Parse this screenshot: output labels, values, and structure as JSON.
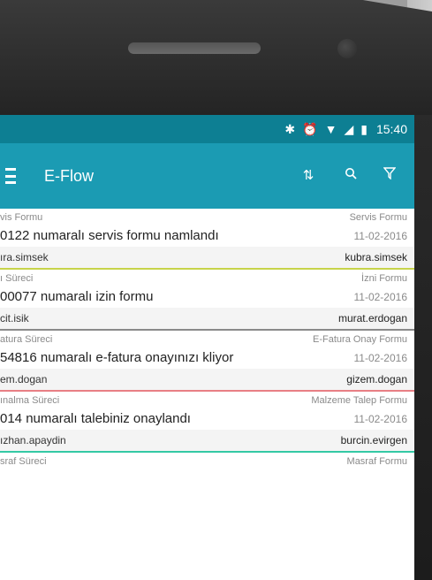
{
  "status_bar": {
    "time": "15:40",
    "icons": [
      "bluetooth-icon",
      "alarm-icon",
      "wifi-icon",
      "signal-icon",
      "battery-icon"
    ]
  },
  "app_bar": {
    "title": "E-Flow",
    "actions": [
      "sort-icon",
      "search-icon",
      "filter-icon"
    ]
  },
  "items": [
    {
      "process": "vis Formu",
      "form_type": "Servis Formu",
      "title": "0122 numaralı servis formu namlandı",
      "date": "11-02-2016",
      "from_user": "ıra.simsek",
      "to_user": "kubra.simsek",
      "accent": "#c7d34a"
    },
    {
      "process": "ı Süreci",
      "form_type": "İzni Formu",
      "title": "00077 numaralı izin formu",
      "date": "11-02-2016",
      "from_user": "cit.isik",
      "to_user": "murat.erdogan",
      "accent": "#8a8a8a"
    },
    {
      "process": "atura Süreci",
      "form_type": "E-Fatura Onay Formu",
      "title": "54816 numaralı e-fatura onayınızı kliyor",
      "date": "11-02-2016",
      "from_user": "em.dogan",
      "to_user": "gizem.dogan",
      "accent": "#e87f85"
    },
    {
      "process": "ınalma Süreci",
      "form_type": "Malzeme Talep Formu",
      "title": "014 numaralı talebiniz onaylandı",
      "date": "11-02-2016",
      "from_user": "ızhan.apaydin",
      "to_user": "burcin.evirgen",
      "accent": "#34c9a5"
    },
    {
      "process": "sraf Süreci",
      "form_type": "Masraf Formu",
      "title": "",
      "date": "",
      "from_user": "",
      "to_user": "",
      "accent": "#cccccc"
    }
  ]
}
